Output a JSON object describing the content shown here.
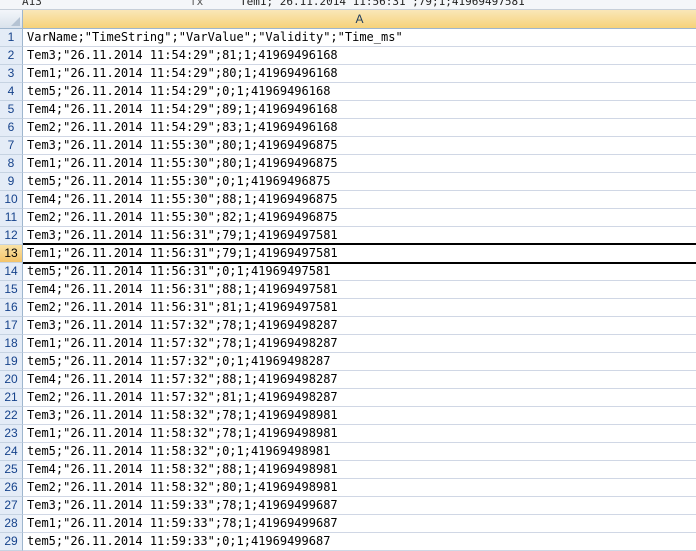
{
  "formula_bar": {
    "cell_ref": "A13",
    "fx_label": "fx",
    "content": "Tem1;\"26.11.2014 11:56:31\";79;1;41969497581"
  },
  "column_header": {
    "label": "A"
  },
  "selected_row": 13,
  "rows": [
    {
      "num": "1",
      "text": "VarName;\"TimeString\";\"VarValue\";\"Validity\";\"Time_ms\""
    },
    {
      "num": "2",
      "text": "Tem3;\"26.11.2014 11:54:29\";81;1;41969496168"
    },
    {
      "num": "3",
      "text": "Tem1;\"26.11.2014 11:54:29\";80;1;41969496168"
    },
    {
      "num": "4",
      "text": "tem5;\"26.11.2014 11:54:29\";0;1;41969496168"
    },
    {
      "num": "5",
      "text": "Tem4;\"26.11.2014 11:54:29\";89;1;41969496168"
    },
    {
      "num": "6",
      "text": "Tem2;\"26.11.2014 11:54:29\";83;1;41969496168"
    },
    {
      "num": "7",
      "text": "Tem3;\"26.11.2014 11:55:30\";80;1;41969496875"
    },
    {
      "num": "8",
      "text": "Tem1;\"26.11.2014 11:55:30\";80;1;41969496875"
    },
    {
      "num": "9",
      "text": "tem5;\"26.11.2014 11:55:30\";0;1;41969496875"
    },
    {
      "num": "10",
      "text": "Tem4;\"26.11.2014 11:55:30\";88;1;41969496875"
    },
    {
      "num": "11",
      "text": "Tem2;\"26.11.2014 11:55:30\";82;1;41969496875"
    },
    {
      "num": "12",
      "text": "Tem3;\"26.11.2014 11:56:31\";79;1;41969497581"
    },
    {
      "num": "13",
      "text": "Tem1;\"26.11.2014 11:56:31\";79;1;41969497581"
    },
    {
      "num": "14",
      "text": "tem5;\"26.11.2014 11:56:31\";0;1;41969497581"
    },
    {
      "num": "15",
      "text": "Tem4;\"26.11.2014 11:56:31\";88;1;41969497581"
    },
    {
      "num": "16",
      "text": "Tem2;\"26.11.2014 11:56:31\";81;1;41969497581"
    },
    {
      "num": "17",
      "text": "Tem3;\"26.11.2014 11:57:32\";78;1;41969498287"
    },
    {
      "num": "18",
      "text": "Tem1;\"26.11.2014 11:57:32\";78;1;41969498287"
    },
    {
      "num": "19",
      "text": "tem5;\"26.11.2014 11:57:32\";0;1;41969498287"
    },
    {
      "num": "20",
      "text": "Tem4;\"26.11.2014 11:57:32\";88;1;41969498287"
    },
    {
      "num": "21",
      "text": "Tem2;\"26.11.2014 11:57:32\";81;1;41969498287"
    },
    {
      "num": "22",
      "text": "Tem3;\"26.11.2014 11:58:32\";78;1;41969498981"
    },
    {
      "num": "23",
      "text": "Tem1;\"26.11.2014 11:58:32\";78;1;41969498981"
    },
    {
      "num": "24",
      "text": "tem5;\"26.11.2014 11:58:32\";0;1;41969498981"
    },
    {
      "num": "25",
      "text": "Tem4;\"26.11.2014 11:58:32\";88;1;41969498981"
    },
    {
      "num": "26",
      "text": "Tem2;\"26.11.2014 11:58:32\";80;1;41969498981"
    },
    {
      "num": "27",
      "text": "Tem3;\"26.11.2014 11:59:33\";78;1;41969499687"
    },
    {
      "num": "28",
      "text": "Tem1;\"26.11.2014 11:59:33\";78;1;41969499687"
    },
    {
      "num": "29",
      "text": "tem5;\"26.11.2014 11:59:33\";0;1;41969499687"
    }
  ]
}
